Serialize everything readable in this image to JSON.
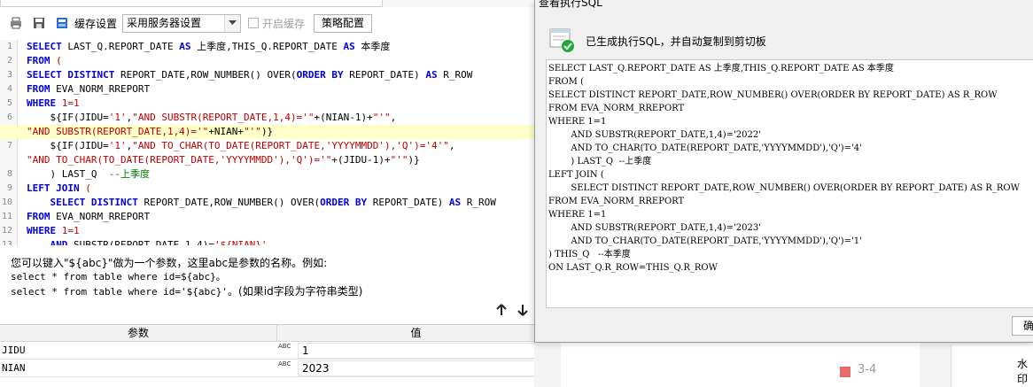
{
  "toolbar": {
    "cache_label": "缓存设置",
    "cache_select_value": "采用服务器设置",
    "enable_cache_label": "开启缓存",
    "strategy_button": "策略配置"
  },
  "editor": {
    "lines": [
      {
        "n": "1",
        "tokens": [
          [
            "kw",
            "SELECT"
          ],
          [
            "t",
            " LAST_Q.REPORT_DATE "
          ],
          [
            "kw",
            "AS"
          ],
          [
            "t",
            " 上季度,THIS_Q.REPORT_DATE "
          ],
          [
            "kw",
            "AS"
          ],
          [
            "t",
            " 本季度"
          ]
        ]
      },
      {
        "n": "2",
        "tokens": [
          [
            "kw",
            "FROM"
          ],
          [
            "t",
            " "
          ],
          [
            "str",
            "("
          ]
        ]
      },
      {
        "n": "3",
        "tokens": [
          [
            "kw",
            "SELECT DISTINCT"
          ],
          [
            "t",
            " REPORT_DATE,ROW_NUMBER() OVER("
          ],
          [
            "kw",
            "ORDER BY"
          ],
          [
            "t",
            " REPORT_DATE) "
          ],
          [
            "kw",
            "AS"
          ],
          [
            "t",
            " R_ROW"
          ]
        ]
      },
      {
        "n": "4",
        "tokens": [
          [
            "kw",
            "FROM"
          ],
          [
            "t",
            " EVA_NORM_RREPORT"
          ]
        ]
      },
      {
        "n": "5",
        "tokens": [
          [
            "kw",
            "WHERE"
          ],
          [
            "t",
            " "
          ],
          [
            "str",
            "1=1"
          ]
        ]
      },
      {
        "n": "6",
        "tokens": [
          [
            "t",
            "    ${IF(JIDU="
          ],
          [
            "str",
            "'1'"
          ],
          [
            "t",
            ","
          ],
          [
            "str",
            "\"AND SUBSTR(REPORT_DATE,1,4)='\""
          ],
          [
            "t",
            "+(NIAN-1)+"
          ],
          [
            "str",
            "\"'\""
          ],
          [
            "t",
            ","
          ]
        ]
      },
      {
        "n": "",
        "hl": true,
        "tokens": [
          [
            "str",
            "\"AND SUBSTR(REPORT_DATE,1,4)='\""
          ],
          [
            "t",
            "+NIAN+"
          ],
          [
            "str",
            "\"'\""
          ],
          [
            "t",
            ")}"
          ]
        ]
      },
      {
        "n": "7",
        "tokens": [
          [
            "t",
            "    ${IF(JIDU="
          ],
          [
            "str",
            "'1'"
          ],
          [
            "t",
            ","
          ],
          [
            "str",
            "\"AND TO_CHAR(TO_DATE(REPORT_DATE,'YYYYMMDD'),'Q')='4'\""
          ],
          [
            "t",
            ","
          ]
        ]
      },
      {
        "n": "",
        "tokens": [
          [
            "str",
            "\"AND TO_CHAR(TO_DATE(REPORT_DATE,'YYYYMMDD'),'Q')='\""
          ],
          [
            "t",
            "+(JIDU-1)+"
          ],
          [
            "str",
            "\"'\""
          ],
          [
            "t",
            ")}"
          ]
        ]
      },
      {
        "n": "8",
        "tokens": [
          [
            "t",
            "    ) LAST_Q  "
          ],
          [
            "cm",
            "--上季度"
          ]
        ]
      },
      {
        "n": "9",
        "tokens": [
          [
            "kw",
            "LEFT JOIN"
          ],
          [
            "t",
            " "
          ],
          [
            "str",
            "("
          ]
        ]
      },
      {
        "n": "10",
        "tokens": [
          [
            "t",
            "    "
          ],
          [
            "kw",
            "SELECT DISTINCT"
          ],
          [
            "t",
            " REPORT_DATE,ROW_NUMBER() OVER("
          ],
          [
            "kw",
            "ORDER BY"
          ],
          [
            "t",
            " REPORT_DATE) "
          ],
          [
            "kw",
            "AS"
          ],
          [
            "t",
            " R_ROW"
          ]
        ]
      },
      {
        "n": "11",
        "tokens": [
          [
            "kw",
            "FROM"
          ],
          [
            "t",
            " EVA_NORM_RREPORT"
          ]
        ]
      },
      {
        "n": "12",
        "tokens": [
          [
            "kw",
            "WHERE"
          ],
          [
            "t",
            " "
          ],
          [
            "str",
            "1=1"
          ]
        ]
      },
      {
        "n": "13",
        "tokens": [
          [
            "t",
            "    "
          ],
          [
            "kw",
            "AND"
          ],
          [
            "t",
            " SUBSTR(REPORT_DATE,1,4)="
          ],
          [
            "str",
            "'${NIAN}'"
          ]
        ]
      }
    ]
  },
  "hint": {
    "line1": "您可以键入\"${abc}\"做为一个参数，这里abc是参数的名称。例如:",
    "line2": "select * from table where id=${abc}。",
    "line3a": "select * from table where id='${abc}'",
    "line3b": "。(如果id字段为字符串类型)"
  },
  "params": {
    "header_name": "参数",
    "header_value": "值",
    "rows": [
      {
        "name": "JIDU",
        "type": "ABC",
        "value": "1"
      },
      {
        "name": "NIAN",
        "type": "ABC",
        "value": "2023"
      }
    ]
  },
  "background": {
    "badge_label": "3-4",
    "card_label": "水印"
  },
  "dialog": {
    "title": "查看执行SQL",
    "message": "已生成执行SQL，并自动复制到剪切板",
    "sql_text": "SELECT LAST_Q.REPORT_DATE AS 上季度,THIS_Q.REPORT_DATE AS 本季度\nFROM (\nSELECT DISTINCT REPORT_DATE,ROW_NUMBER() OVER(ORDER BY REPORT_DATE) AS R_ROW\nFROM EVA_NORM_RREPORT\nWHERE 1=1\n        AND SUBSTR(REPORT_DATE,1,4)='2022'\n        AND TO_CHAR(TO_DATE(REPORT_DATE,'YYYYMMDD'),'Q')='4'\n        ) LAST_Q  --上季度\nLEFT JOIN (\n        SELECT DISTINCT REPORT_DATE,ROW_NUMBER() OVER(ORDER BY REPORT_DATE) AS R_ROW\nFROM EVA_NORM_RREPORT\nWHERE 1=1\n        AND SUBSTR(REPORT_DATE,1,4)='2023'\n        AND TO_CHAR(TO_DATE(REPORT_DATE,'YYYYMMDD'),'Q')='1'\n) THIS_Q   --本季度\nON LAST_Q.R_ROW=THIS_Q.R_ROW",
    "ok_label": "确定"
  },
  "icons": {
    "print": "print-icon",
    "save": "save-icon",
    "cache_settings": "cache-settings-icon",
    "dropdown": "chevron-down-icon",
    "move_up": "arrow-up-icon",
    "move_down": "arrow-down-icon",
    "success": "check-success-icon"
  },
  "colors": {
    "keyword": "#0000e0",
    "string": "#c00000",
    "comment": "#008000",
    "highlight": "#ffffc8",
    "success": "#1faa3a"
  }
}
